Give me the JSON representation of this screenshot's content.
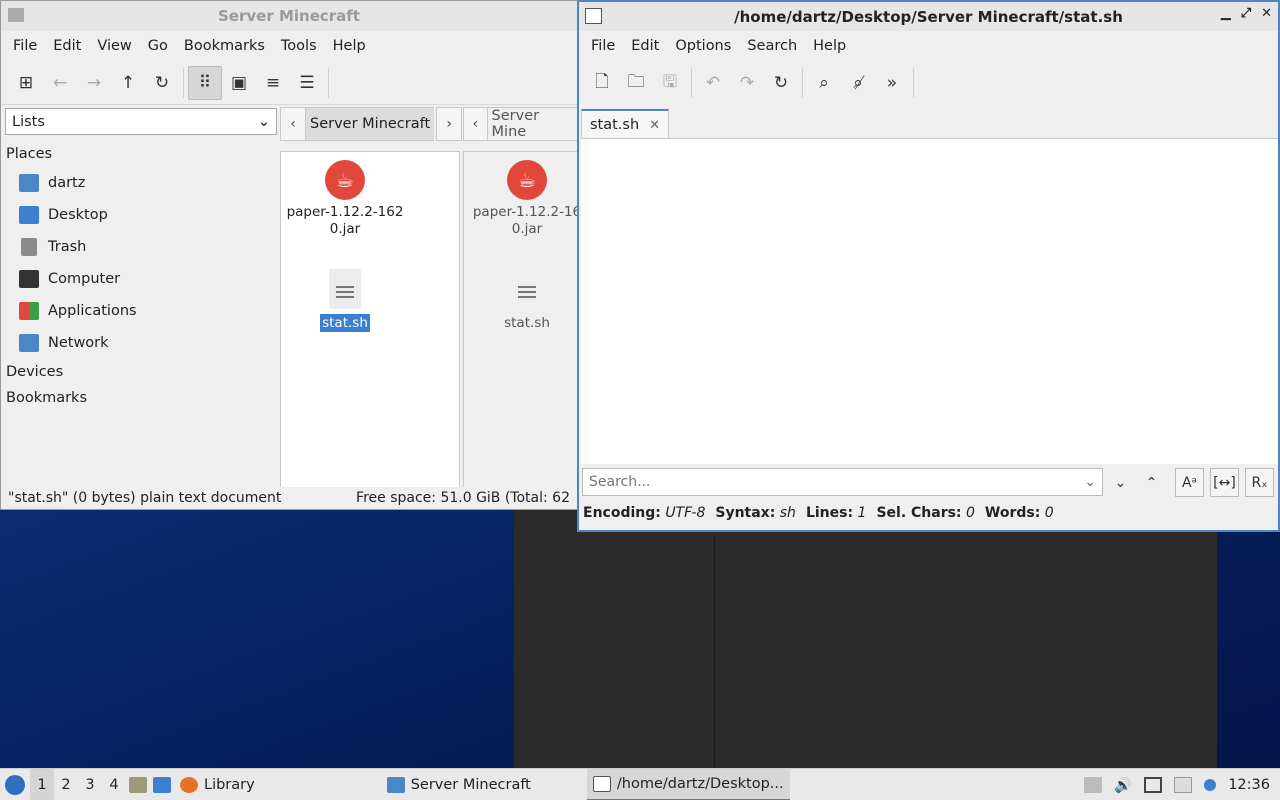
{
  "file_manager": {
    "title": "Server Minecraft",
    "menu": [
      "File",
      "Edit",
      "View",
      "Go",
      "Bookmarks",
      "Tools",
      "Help"
    ],
    "side_select": "Lists",
    "places_header": "Places",
    "places": [
      {
        "label": "dartz",
        "icon": "home-folder-icon",
        "color": "#4a86c8"
      },
      {
        "label": "Desktop",
        "icon": "desktop-icon",
        "color": "#3b7fd1"
      },
      {
        "label": "Trash",
        "icon": "trash-icon",
        "color": "#8a8a8a"
      },
      {
        "label": "Computer",
        "icon": "computer-icon",
        "color": "#333333"
      },
      {
        "label": "Applications",
        "icon": "applications-icon",
        "color": "#e2473b"
      },
      {
        "label": "Network",
        "icon": "network-folder-icon",
        "color": "#4a86c8"
      }
    ],
    "devices_header": "Devices",
    "bookmarks_header": "Bookmarks",
    "pane1": {
      "crumb": "Server Minecraft",
      "files": [
        {
          "name_line1": "paper-1.12.2-162",
          "name_line2": "0.jar",
          "type": "java"
        },
        {
          "name_line1": "stat.sh",
          "type": "text",
          "selected": true
        }
      ]
    },
    "pane2": {
      "crumb": "Server Mine",
      "files": [
        {
          "name_line1": "paper-1.12.2-16",
          "name_line2": "0.jar",
          "type": "java"
        },
        {
          "name_line1": "stat.sh",
          "type": "text"
        }
      ]
    },
    "status_left": "\"stat.sh\" (0 bytes) plain text document",
    "status_right": "Free space: 51.0 GiB (Total: 62"
  },
  "editor": {
    "title": "/home/dartz/Desktop/Server Minecraft/stat.sh",
    "menu": [
      "File",
      "Edit",
      "Options",
      "Search",
      "Help"
    ],
    "tab_label": "stat.sh",
    "search_placeholder": "Search...",
    "status": {
      "encoding_label": "Encoding:",
      "encoding": "UTF-8",
      "syntax_label": "Syntax:",
      "syntax": "sh",
      "lines_label": "Lines:",
      "lines": "1",
      "selchars_label": "Sel. Chars:",
      "selchars": "0",
      "words_label": "Words:",
      "words": "0"
    }
  },
  "taskbar": {
    "workspaces": [
      "1",
      "2",
      "3",
      "4"
    ],
    "tasks": [
      {
        "label": "Library",
        "icon": "firefox-icon"
      },
      {
        "label": "Server Minecraft",
        "icon": "folder-icon"
      },
      {
        "label": "/home/dartz/Desktop...",
        "icon": "text-editor-icon"
      }
    ],
    "clock": "12:36"
  }
}
